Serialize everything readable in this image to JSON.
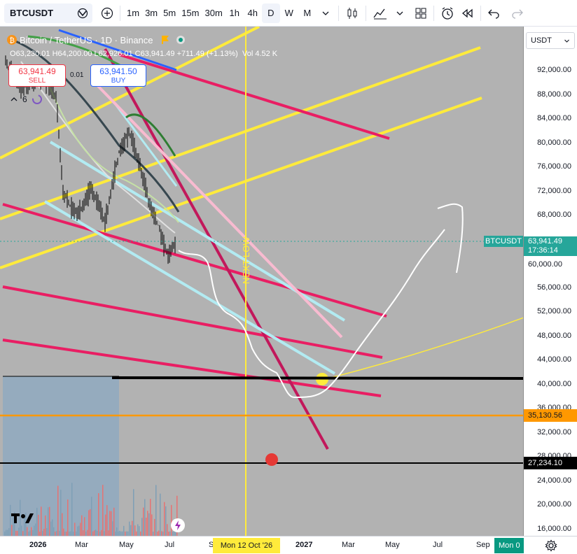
{
  "toolbar": {
    "symbol": "BTCUSDT",
    "intervals": [
      "1m",
      "3m",
      "5m",
      "15m",
      "30m",
      "1h",
      "4h",
      "D",
      "W",
      "M"
    ],
    "active_interval": "D"
  },
  "legend": {
    "title": "Bitcoin / TetherUS · 1D · Binance",
    "open_label": "O",
    "open": "63,230.01",
    "high_label": "H",
    "high": "64,200.00",
    "low_label": "L",
    "low": "62,926.01",
    "close_label": "C",
    "close": "63,941.49",
    "change": "+711.49 (+1.13%)",
    "vol_label": "Vol",
    "vol": "4.52 K"
  },
  "trade": {
    "sell_price": "63,941.49",
    "sell_label": "SELL",
    "spread": "0.01",
    "buy_price": "63,941.50",
    "buy_label": "BUY",
    "indicator_count": "6"
  },
  "annotation": {
    "text": "NEXT LOW"
  },
  "price_axis": {
    "currency": "USDT",
    "ticks": [
      "92,000.00",
      "88,000.00",
      "84,000.00",
      "80,000.00",
      "76,000.00",
      "72,000.00",
      "68,000.00",
      "56,000.00",
      "52,000.00",
      "48,000.00",
      "44,000.00",
      "40,000.00",
      "36,000.00",
      "32,000.00",
      "28,000.00",
      "24,000.00",
      "20,000.00",
      "16,000.00"
    ],
    "symbol_tag": "BTCUSDT",
    "current_price": "63,941.49",
    "countdown": "17:36:14",
    "tag_60k": "60,000.00",
    "orange_level": "35,130.56",
    "black_level": "27,234.10"
  },
  "time_axis": {
    "labels": [
      "2026",
      "Mar",
      "May",
      "Jul",
      "Sep",
      "2027",
      "Mar",
      "May",
      "Jul",
      "Sep"
    ],
    "crosshair_label": "Mon 12 Oct '26",
    "right_label": "Mon 0"
  },
  "colors": {
    "chart_bg": "#b2b2b2",
    "yellow_line": "#ffeb3b",
    "magenta_line": "#e91e63",
    "light_cyan": "#b2ebf2",
    "orange_line": "#ff9800",
    "green_tag": "#26a69a"
  }
}
